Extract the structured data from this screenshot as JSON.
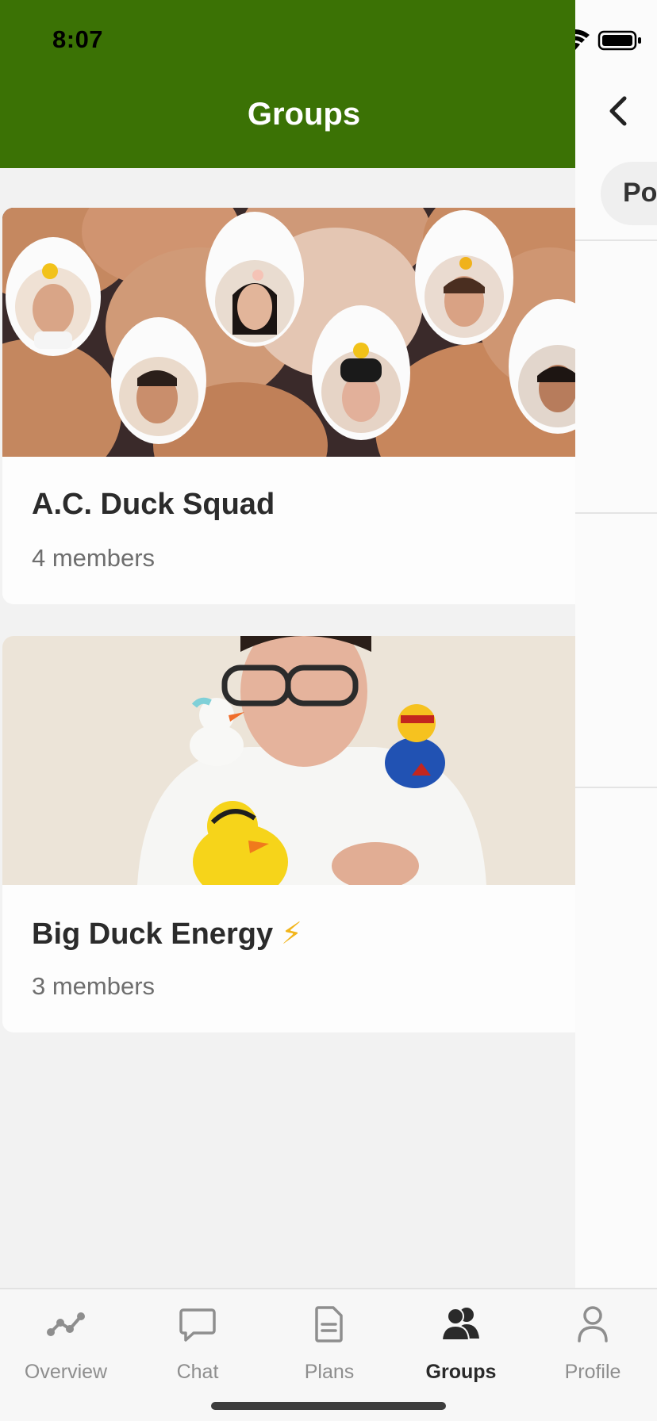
{
  "status": {
    "time": "8:07"
  },
  "header": {
    "title": "Groups"
  },
  "groups": [
    {
      "name": "A.C. Duck Squad",
      "members": "4 members",
      "image": "eggs-with-member-faces"
    },
    {
      "name": "Big Duck Energy",
      "badge": "⚡",
      "members": "3 members",
      "image": "person-with-rubber-ducks"
    }
  ],
  "side_panel": {
    "chip_label": "Po"
  },
  "tabs": [
    {
      "label": "Overview",
      "icon": "overview-icon",
      "active": false
    },
    {
      "label": "Chat",
      "icon": "chat-icon",
      "active": false
    },
    {
      "label": "Plans",
      "icon": "document-icon",
      "active": false
    },
    {
      "label": "Groups",
      "icon": "groups-icon",
      "active": true
    },
    {
      "label": "Profile",
      "icon": "profile-icon",
      "active": false
    }
  ],
  "colors": {
    "header": "#3b7205",
    "accent_bolt": "#f2b51b",
    "tab_active": "#2a2a2a",
    "tab_inactive": "#8e8e8e"
  }
}
